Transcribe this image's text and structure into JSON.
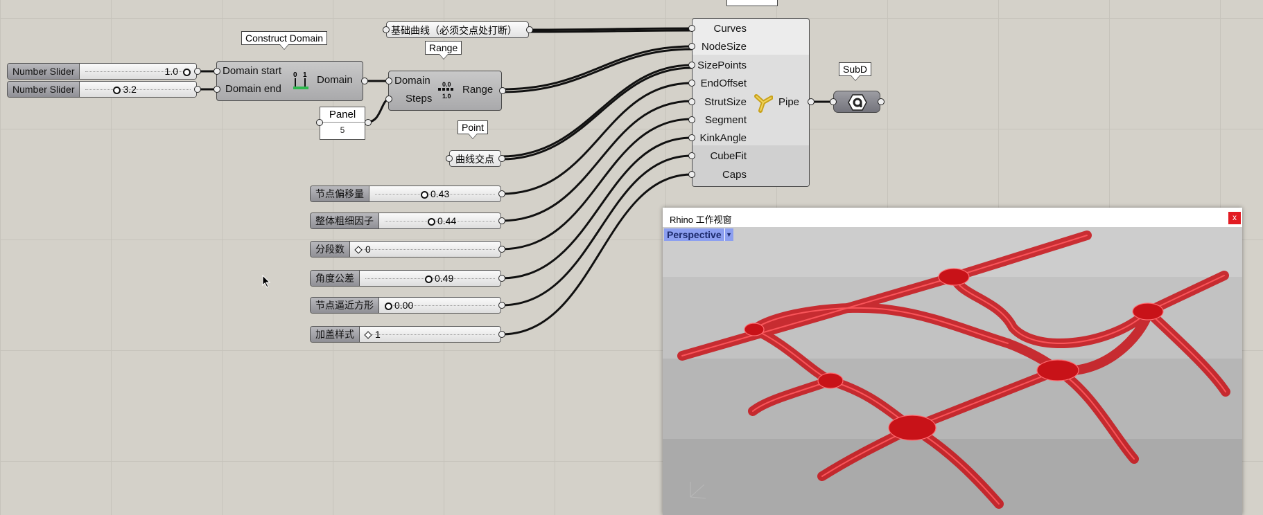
{
  "components": {
    "construct_domain": {
      "tooltip": "Construct Domain",
      "input_start": "Domain start",
      "input_end": "Domain end",
      "output": "Domain"
    },
    "range": {
      "tooltip": "Range",
      "input_domain": "Domain",
      "input_steps": "Steps",
      "output": "Range",
      "icon_top": "0.0",
      "icon_bottom": "1.0"
    },
    "panel": {
      "title": "Panel",
      "value": "5"
    },
    "point": {
      "tooltip": "Point",
      "label": "曲线交点"
    },
    "curves_param": {
      "label": "基础曲线（必须交点处打断）"
    },
    "pipe": {
      "inputs": [
        "Curves",
        "NodeSize",
        "SizePoints",
        "EndOffset",
        "StrutSize",
        "Segment",
        "KinkAngle",
        "CubeFit",
        "Caps"
      ],
      "output": "Pipe"
    },
    "subd": {
      "tooltip": "SubD"
    }
  },
  "sliders": [
    {
      "label": "Number Slider",
      "value": "1.0",
      "control": "knob",
      "level": 0.95
    },
    {
      "label": "Number Slider",
      "value": "3.2",
      "control": "knob",
      "level": 0.3
    },
    {
      "label": "节点偏移量",
      "value": "0.43",
      "control": "knob",
      "level": 0.43
    },
    {
      "label": "整体粗细因子",
      "value": "0.44",
      "control": "knob",
      "level": 0.44
    },
    {
      "label": "分段数",
      "value": "0",
      "control": "diamond",
      "level": 0.0
    },
    {
      "label": "角度公差",
      "value": "0.49",
      "control": "knob",
      "level": 0.49
    },
    {
      "label": "节点逼近方形",
      "value": "0.00",
      "control": "knob",
      "level": 0.0
    },
    {
      "label": "加盖样式",
      "value": "1",
      "control": "diamond",
      "level": 0.1
    }
  ],
  "viewport": {
    "window_title": "Rhino 工作视窗",
    "view_name": "Perspective",
    "close_label": "x"
  },
  "colors": {
    "canvas": "#d4d1c9",
    "grid": "#c6c3bb",
    "wire": "#111111",
    "mesh": "#d9151d",
    "persp_bg": "#8c9ff0"
  }
}
